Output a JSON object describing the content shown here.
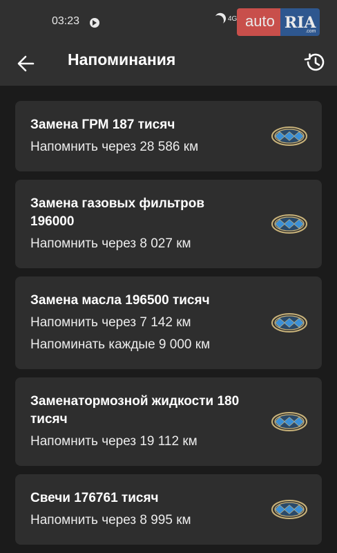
{
  "status_bar": {
    "time": "03:23",
    "signal_text": "4G"
  },
  "watermark": {
    "auto": "auto",
    "ria": "RIA",
    "com": ".com"
  },
  "app_bar": {
    "title": "Напоминания",
    "back_icon": "arrow-left-icon",
    "history_icon": "history-icon"
  },
  "reminders": [
    {
      "title": "Замена ГРМ 187 тисяч",
      "lines": [
        "Напомнить через 28 586 км"
      ]
    },
    {
      "title": "Замена газовых фильтров 196000",
      "lines": [
        "Напомнить через 8 027 км"
      ]
    },
    {
      "title": "Замена масла 196500 тисяч",
      "lines": [
        "Напомнить через 7 142 км",
        "Напоминать каждые 9 000 км"
      ]
    },
    {
      "title": "Заменатормозной жидкости 180 тисяч",
      "lines": [
        "Напомнить через 19 112 км"
      ]
    },
    {
      "title": "Свечи 176761 тисяч",
      "lines": [
        "Напомнить через 8 995 км"
      ]
    }
  ],
  "colors": {
    "background": "#1b1b1b",
    "bar": "#303030",
    "card": "#2e2e2e",
    "logo_blue": "#3b8fd6",
    "logo_gold": "#c9b37a"
  }
}
